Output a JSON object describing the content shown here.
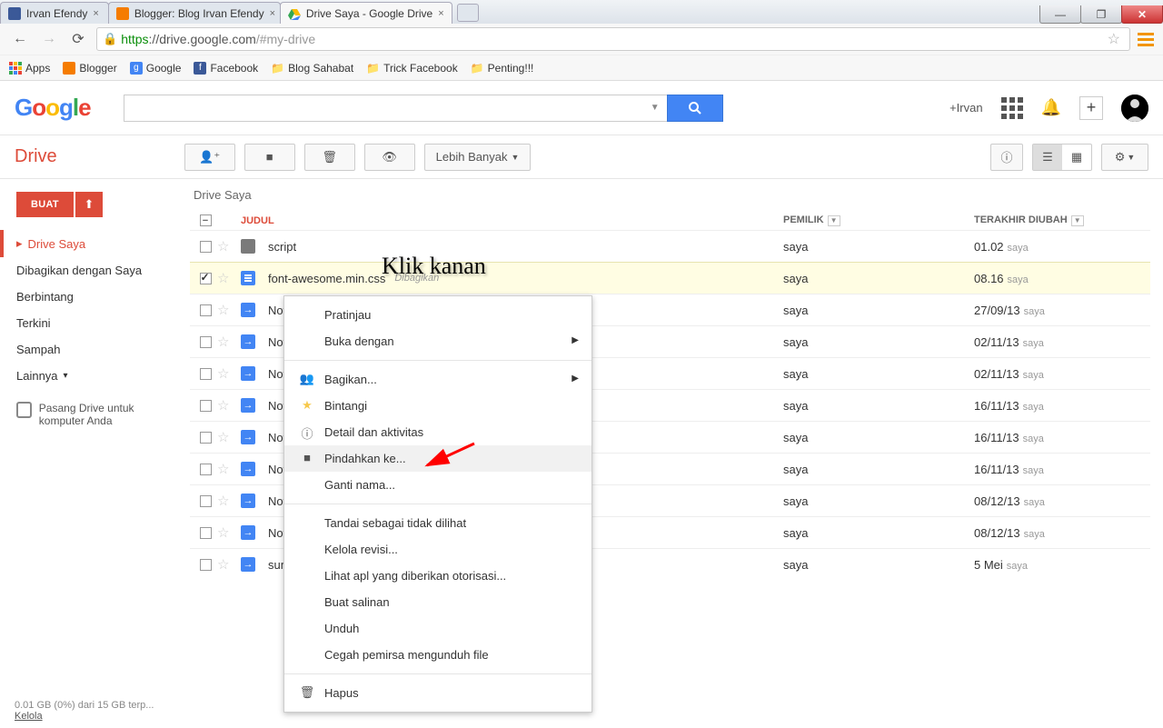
{
  "window": {
    "tabs": [
      {
        "title": "Irvan Efendy",
        "close": "×"
      },
      {
        "title": "Blogger: Blog Irvan Efendy",
        "close": "×"
      },
      {
        "title": "Drive Saya - Google Drive",
        "close": "×"
      }
    ],
    "url_https": "https",
    "url_host": "://drive.google.com",
    "url_path": "/#my-drive"
  },
  "bookmarks_bar": {
    "apps": "Apps",
    "items": [
      {
        "label": "Blogger",
        "color": "#f57c00"
      },
      {
        "label": "Google",
        "color": "#4285F4"
      },
      {
        "label": "Facebook",
        "color": "#3b5998"
      }
    ],
    "folders": [
      "Blog Sahabat",
      "Trick Facebook",
      "Penting!!!"
    ]
  },
  "googlebar": {
    "user": "+Irvan"
  },
  "drive": {
    "label": "Drive",
    "more": "Lebih Banyak",
    "create": "BUAT",
    "breadcrumb": "Drive Saya",
    "nav": [
      {
        "label": "Drive Saya",
        "active": true,
        "caret": "▸"
      },
      {
        "label": "Dibagikan dengan Saya"
      },
      {
        "label": "Berbintang"
      },
      {
        "label": "Terkini"
      },
      {
        "label": "Sampah"
      },
      {
        "label": "Lainnya",
        "caret": "▾"
      }
    ],
    "install": "Pasang Drive untuk komputer Anda",
    "columns": {
      "title": "JUDUL",
      "owner": "PEMILIK",
      "modified": "TERAKHIR DIUBAH"
    },
    "rows": [
      {
        "type": "folder",
        "title": "script",
        "owner": "saya",
        "mod": "01.02",
        "by": "saya"
      },
      {
        "type": "doc",
        "title": "font-awesome.min.css",
        "shared": "Dibagikan",
        "owner": "saya",
        "mod": "08.16",
        "by": "saya",
        "selected": true
      },
      {
        "type": "arrow",
        "title": "Notif",
        "owner": "saya",
        "mod": "27/09/13",
        "by": "saya"
      },
      {
        "type": "arrow",
        "title": "Notif",
        "owner": "saya",
        "mod": "02/11/13",
        "by": "saya"
      },
      {
        "type": "arrow",
        "title": "Notif",
        "owner": "saya",
        "mod": "02/11/13",
        "by": "saya"
      },
      {
        "type": "arrow",
        "title": "Notif",
        "owner": "saya",
        "mod": "16/11/13",
        "by": "saya"
      },
      {
        "type": "arrow",
        "title": "Notif",
        "owner": "saya",
        "mod": "16/11/13",
        "by": "saya"
      },
      {
        "type": "arrow",
        "title": "Notif",
        "owner": "saya",
        "mod": "16/11/13",
        "by": "saya"
      },
      {
        "type": "arrow",
        "title": "Notif",
        "owner": "saya",
        "mod": "08/12/13",
        "by": "saya"
      },
      {
        "type": "arrow",
        "title": "Notif",
        "owner": "saya",
        "mod": "08/12/13",
        "by": "saya"
      },
      {
        "type": "arrow",
        "title": "sundu",
        "owner": "saya",
        "mod": "5 Mei",
        "by": "saya"
      }
    ],
    "storage": "0.01 GB (0%) dari 15 GB terp...",
    "manage": "Kelola"
  },
  "ctx": [
    {
      "label": "Pratinjau"
    },
    {
      "label": "Buka dengan",
      "arrow": true
    },
    {
      "sep": true
    },
    {
      "label": "Bagikan...",
      "icon": "👥",
      "arrow": true
    },
    {
      "label": "Bintangi",
      "icon": "★",
      "star": true
    },
    {
      "label": "Detail dan aktivitas",
      "icon": "ⓘ"
    },
    {
      "label": "Pindahkan ke...",
      "icon": "■",
      "hl": true
    },
    {
      "label": "Ganti nama..."
    },
    {
      "sep": true
    },
    {
      "label": "Tandai sebagai tidak dilihat"
    },
    {
      "label": "Kelola revisi..."
    },
    {
      "label": "Lihat apl yang diberikan otorisasi..."
    },
    {
      "label": "Buat salinan"
    },
    {
      "label": "Unduh"
    },
    {
      "label": "Cegah pemirsa mengunduh file"
    },
    {
      "sep": true
    },
    {
      "label": "Hapus",
      "icon": "🗑"
    }
  ],
  "annotation": "Klik kanan"
}
